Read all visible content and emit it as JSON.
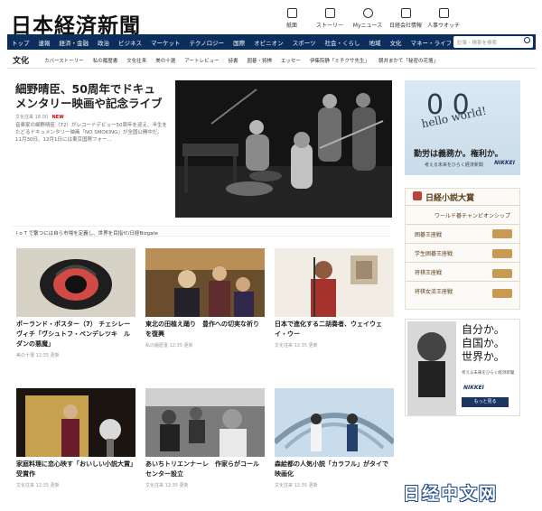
{
  "header": {
    "logo": "日本経済新聞",
    "icons": [
      {
        "label": "紙面",
        "icon": "newspaper-icon"
      },
      {
        "label": "ストーリー",
        "icon": "story-icon"
      },
      {
        "label": "Myニュース",
        "icon": "user-icon"
      },
      {
        "label": "日経会社情報",
        "icon": "company-info-icon"
      },
      {
        "label": "人事ウオッチ",
        "icon": "personnel-icon"
      }
    ]
  },
  "nav": {
    "items": [
      "トップ",
      "速報",
      "経済・金融",
      "政治",
      "ビジネス",
      "マーケット",
      "テクノロジー",
      "国際",
      "オピニオン",
      "スポーツ",
      "社会・くらし",
      "地域",
      "文化",
      "マネー・ライフ"
    ],
    "search_placeholder": "記事・検索を検索"
  },
  "subnav": {
    "title": "文化",
    "items": [
      "カバーストーリー",
      "私の履歴書",
      "文化往来",
      "美の十選",
      "アートレビュー",
      "詩書",
      "囲碁・将棋",
      "エッセー",
      "伊集院静「ミチクサ先生」",
      "朝井まかて「秘密の花壇」"
    ]
  },
  "lead": {
    "title": "細野晴臣、50周年でドキュメンタリー映画や記念ライブ",
    "category": "文化往来",
    "time": "18:00",
    "new_badge": "NEW",
    "description": "音楽家の細野晴臣（72）がレコードデビュー50周年を迎え、半生をたどるドキュメンタリー映画「NO SMOKING」が全国公開中だ。11月30日、12月1日には東京国際フォー…"
  },
  "banner": {
    "text": "I o T で繋つには自ら市場を定義し、世界を目指せ/日経Bizgate"
  },
  "cards": [
    {
      "title": "ポーランド・ポスター（7） チェシレーヴィチ「ヴシュトフ・ペンデレツキ　ルダンの悪魔」",
      "category": "美の十選",
      "time": "12:35",
      "updated": "更新"
    },
    {
      "title": "東北の田植え踊り　豊作への切実な祈りを復興",
      "category": "私の履歴書",
      "time": "12:35",
      "updated": "更新"
    },
    {
      "title": "日本で進化する二胡奏者、ウェイウェイ・ウー",
      "category": "文化往来",
      "time": "12:35",
      "updated": "更新"
    },
    {
      "title": "家庭料理に恋心映す「おいしい小説大賞」受賞作",
      "category": "文化往来",
      "time": "12:35",
      "updated": "更新"
    },
    {
      "title": "あいちトリエンナーレ　作家らがコールセンター設立",
      "category": "文化往来",
      "time": "12:35",
      "updated": "更新"
    },
    {
      "title": "森絵都の人気小説「カラフル」がタイで映画化",
      "category": "文化往来",
      "time": "12:35",
      "updated": "更新"
    }
  ],
  "sidebar": {
    "ad1": {
      "big": "0 0",
      "script": "hello world!",
      "tagline": "勤労は義務か。権利か。",
      "small": "考える未来をひらく経済新聞",
      "brand": "NIKKEI"
    },
    "ad2": {
      "title": "日経小説大賞",
      "items": [
        "ワールド碁チャンピオンシップ",
        "囲碁王座戦",
        "学生囲碁王座戦",
        "将棋王座戦",
        "将棋女流王座戦"
      ]
    },
    "ad3": {
      "lines": [
        "自分か。",
        "自国か。",
        "世界か。"
      ],
      "small": "考える未来をひらく経済新聞",
      "brand": "NIKKEI",
      "more": "もっと見る"
    }
  },
  "watermark": "日经中文网"
}
